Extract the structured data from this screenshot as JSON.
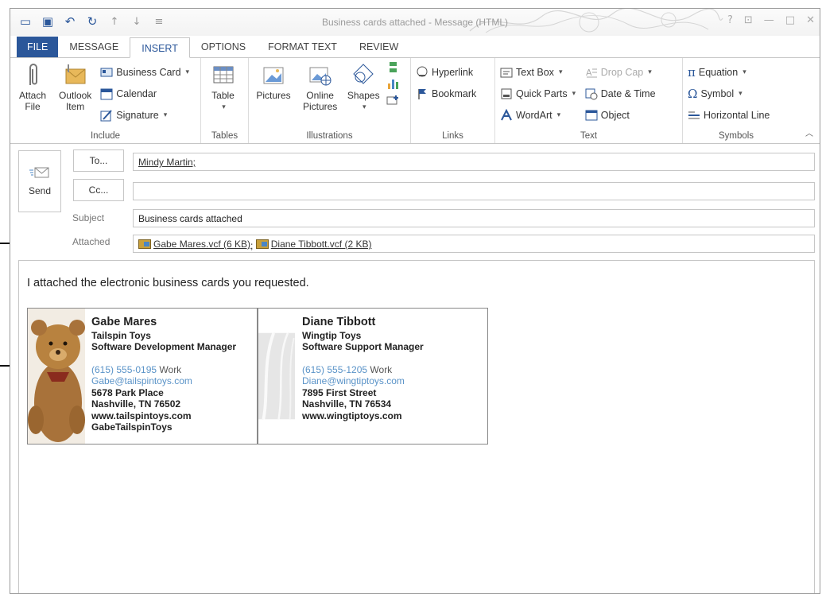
{
  "window": {
    "title": "Business cards attached - Message (HTML)"
  },
  "title_bar": {
    "help": "?"
  },
  "tabs": [
    {
      "label": "FILE"
    },
    {
      "label": "MESSAGE"
    },
    {
      "label": "INSERT"
    },
    {
      "label": "OPTIONS"
    },
    {
      "label": "FORMAT TEXT"
    },
    {
      "label": "REVIEW"
    }
  ],
  "ribbon": {
    "include": {
      "label": "Include",
      "attach_file": "Attach File",
      "outlook_item": "Outlook Item",
      "business_card": "Business Card",
      "calendar": "Calendar",
      "signature": "Signature"
    },
    "tables": {
      "label": "Tables",
      "table": "Table"
    },
    "illustrations": {
      "label": "Illustrations",
      "pictures": "Pictures",
      "online_pictures": "Online Pictures",
      "shapes": "Shapes"
    },
    "links": {
      "label": "Links",
      "hyperlink": "Hyperlink",
      "bookmark": "Bookmark"
    },
    "text": {
      "label": "Text",
      "text_box": "Text Box",
      "quick_parts": "Quick Parts",
      "wordart": "WordArt",
      "drop_cap": "Drop Cap",
      "date_time": "Date & Time",
      "object": "Object"
    },
    "symbols": {
      "label": "Symbols",
      "equation": "Equation",
      "symbol": "Symbol",
      "horizontal_line": "Horizontal Line"
    }
  },
  "message": {
    "send": "Send",
    "to_button": "To...",
    "cc_button": "Cc...",
    "to_value": "Mindy Martin;",
    "cc_value": "",
    "subject_label": "Subject",
    "subject_value": "Business cards attached",
    "attached_label": "Attached",
    "attachments": [
      {
        "name": "Gabe Mares.vcf (6 KB)"
      },
      {
        "name": "Diane Tibbott.vcf (2 KB)"
      }
    ],
    "attachment_separator": ";",
    "body_text": "I attached the electronic business cards you requested."
  },
  "cards": [
    {
      "name": "Gabe Mares",
      "company": "Tailspin Toys",
      "title": "Software Development Manager",
      "phone": "(615) 555-0195",
      "phone_type": "Work",
      "email": "Gabe@tailspintoys.com",
      "street": "5678 Park Place",
      "city": "Nashville, TN 76502",
      "web": "www.tailspintoys.com",
      "im": "GabeTailspinToys"
    },
    {
      "name": "Diane Tibbott",
      "company": "Wingtip Toys",
      "title": "Software Support Manager",
      "phone": "(615) 555-1205",
      "phone_type": "Work",
      "email": "Diane@wingtiptoys.com",
      "street": "7895 First Street",
      "city": "Nashville, TN 76534",
      "web": "www.wingtiptoys.com"
    }
  ],
  "colors": {
    "accent": "#2b579a",
    "link_blue": "#5a93c8"
  }
}
